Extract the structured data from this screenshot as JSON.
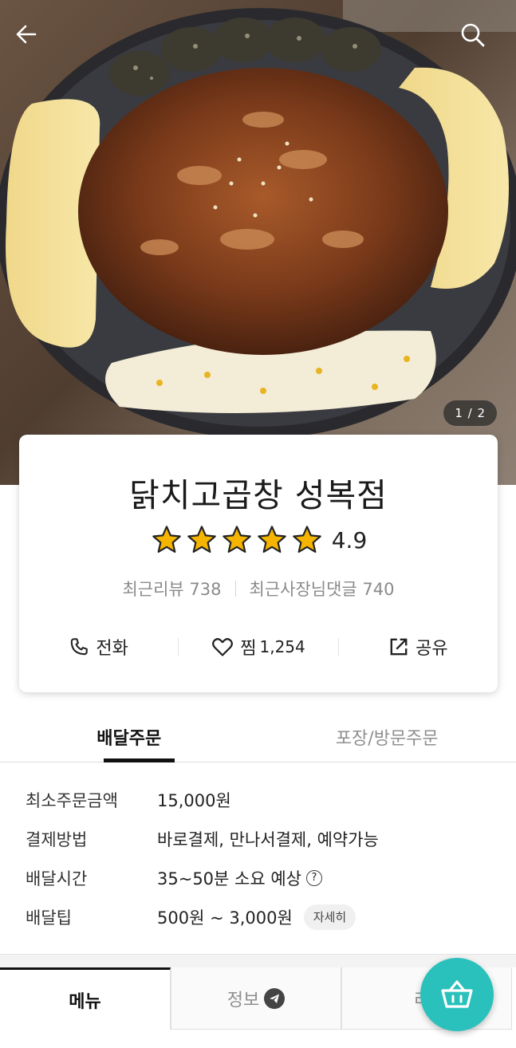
{
  "hero": {
    "photo_alt": "dakchi-gopchang-platter-photo",
    "photo_counter": "1 / 2",
    "back_icon": "arrow-left-icon",
    "search_icon": "search-icon"
  },
  "store": {
    "name": "닭치고곱창 성복점",
    "rating": 4.9,
    "rating_label": "4.9",
    "stars_filled": 5,
    "recent_reviews": "최근리뷰 738",
    "owner_replies": "최근사장님댓글 740",
    "star_color": "#f4b400"
  },
  "actions": {
    "call_label": "전화",
    "like_label": "찜",
    "like_count": "1,254",
    "share_label": "공유"
  },
  "order_tabs": [
    {
      "label": "배달주문",
      "active": true
    },
    {
      "label": "포장/방문주문",
      "active": false
    }
  ],
  "delivery_info": {
    "min_order_label": "최소주문금액",
    "min_order_value": "15,000원",
    "payment_label": "결제방법",
    "payment_value": "바로결제, 만나서결제, 예약가능",
    "time_label": "배달시간",
    "time_value": "35~50분 소요 예상",
    "tip_label": "배달팁",
    "tip_value": "500원 ~ 3,000원",
    "tip_detail": "자세히"
  },
  "bottom_tabs": {
    "menu": "메뉴",
    "info": "정보",
    "third": "리"
  },
  "colors": {
    "accent": "#2ac1bc",
    "tab_active": "#111111"
  }
}
